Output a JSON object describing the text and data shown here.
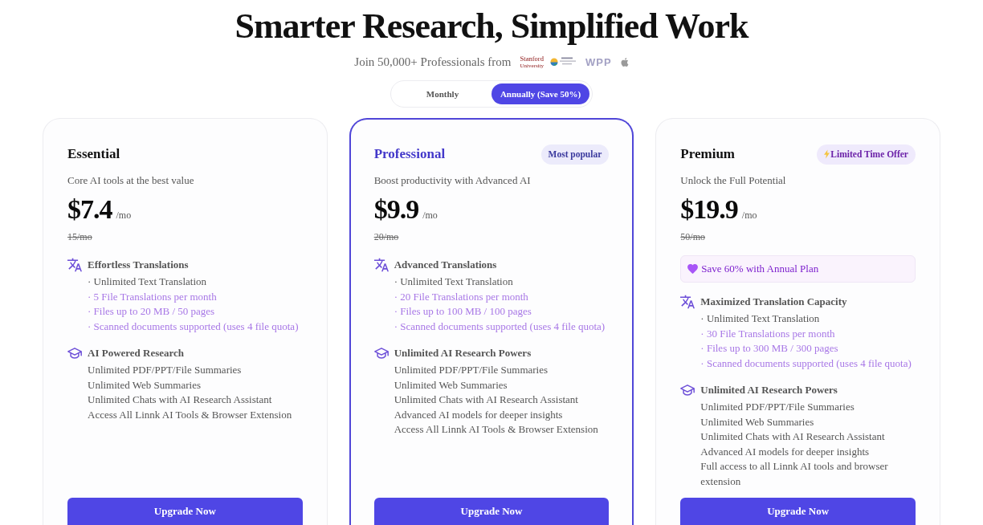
{
  "header": {
    "title": "Smarter Research, Simplified Work",
    "subtitle": "Join 50,000+ Professionals from",
    "logos": [
      {
        "kind": "wordmark_stacked",
        "text": "Stanford",
        "subtext": "University"
      },
      {
        "kind": "emblem"
      },
      {
        "kind": "wordmark",
        "text": "WPP"
      },
      {
        "kind": "fruit"
      }
    ]
  },
  "billing_toggle": [
    {
      "label": "Monthly",
      "selected": false
    },
    {
      "label": "Annually (Save 50%)",
      "selected": true
    }
  ],
  "plans": [
    {
      "name": "Essential",
      "featured": false,
      "tagline": "Core AI tools at the best value",
      "price": "$7.4",
      "period": "/mo",
      "original_price": "15/mo",
      "feature_groups": [
        {
          "kind": "translation",
          "title": "Effortless Translations",
          "items": [
            {
              "text": "· Unlimited Text Translation",
              "highlighted": false
            },
            {
              "text": "· 5 File Translations per month",
              "highlighted": true
            },
            {
              "text": "· Files up to 20 MB / 50 pages",
              "highlighted": true
            },
            {
              "text": "· Scanned documents supported (uses 4 file quota)",
              "highlighted": true
            }
          ]
        },
        {
          "kind": "research",
          "title": "AI Powered Research",
          "items": [
            {
              "text": "Unlimited PDF/PPT/File Summaries",
              "highlighted": false
            },
            {
              "text": "Unlimited Web Summaries",
              "highlighted": false
            },
            {
              "text": "Unlimited Chats with AI Research Assistant",
              "highlighted": false
            },
            {
              "text": "Access All Linnk AI Tools & Browser Extension",
              "highlighted": false
            }
          ]
        }
      ],
      "button": "Upgrade Now"
    },
    {
      "name": "Professional",
      "featured": true,
      "badge": {
        "kind": "popular",
        "text": "Most popular"
      },
      "tagline": "Boost productivity with Advanced AI",
      "price": "$9.9",
      "period": "/mo",
      "original_price": "20/mo",
      "feature_groups": [
        {
          "kind": "translation",
          "title": "Advanced Translations",
          "items": [
            {
              "text": "· Unlimited Text Translation",
              "highlighted": false
            },
            {
              "text": "· 20 File Translations per month",
              "highlighted": true
            },
            {
              "text": "· Files up to 100 MB / 100 pages",
              "highlighted": true
            },
            {
              "text": "· Scanned documents supported (uses 4 file quota)",
              "highlighted": true
            }
          ]
        },
        {
          "kind": "research",
          "title": "Unlimited AI Research Powers",
          "items": [
            {
              "text": "Unlimited PDF/PPT/File Summaries",
              "highlighted": false
            },
            {
              "text": "Unlimited Web Summaries",
              "highlighted": false
            },
            {
              "text": "Unlimited Chats with AI Research Assistant",
              "highlighted": false
            },
            {
              "text": "Advanced AI models for deeper insights",
              "highlighted": false
            },
            {
              "text": "Access All Linnk AI Tools & Browser Extension",
              "highlighted": false
            }
          ]
        }
      ],
      "button": "Upgrade Now"
    },
    {
      "name": "Premium",
      "featured": false,
      "badge": {
        "kind": "offer",
        "text": "Limited Time Offer"
      },
      "tagline": "Unlock the Full Potential",
      "price": "$19.9",
      "period": "/mo",
      "original_price": "50/mo",
      "promo": "Save 60% with Annual Plan",
      "feature_groups": [
        {
          "kind": "translation",
          "title": "Maximized Translation Capacity",
          "items": [
            {
              "text": "· Unlimited Text Translation",
              "highlighted": false
            },
            {
              "text": "· 30 File Translations per month",
              "highlighted": true
            },
            {
              "text": "· Files up to 300 MB / 300 pages",
              "highlighted": true
            },
            {
              "text": "· Scanned documents supported (uses 4 file quota)",
              "highlighted": true
            }
          ]
        },
        {
          "kind": "research",
          "title": "Unlimited AI Research Powers",
          "items": [
            {
              "text": "Unlimited PDF/PPT/File Summaries",
              "highlighted": false
            },
            {
              "text": "Unlimited Web Summaries",
              "highlighted": false
            },
            {
              "text": "Unlimited Chats with AI Research Assistant",
              "highlighted": false
            },
            {
              "text": "Advanced AI models for deeper insights",
              "highlighted": false
            },
            {
              "text": "Full access to all Linnk AI tools and browser extension",
              "highlighted": false
            }
          ]
        }
      ],
      "button": "Upgrade Now"
    }
  ]
}
